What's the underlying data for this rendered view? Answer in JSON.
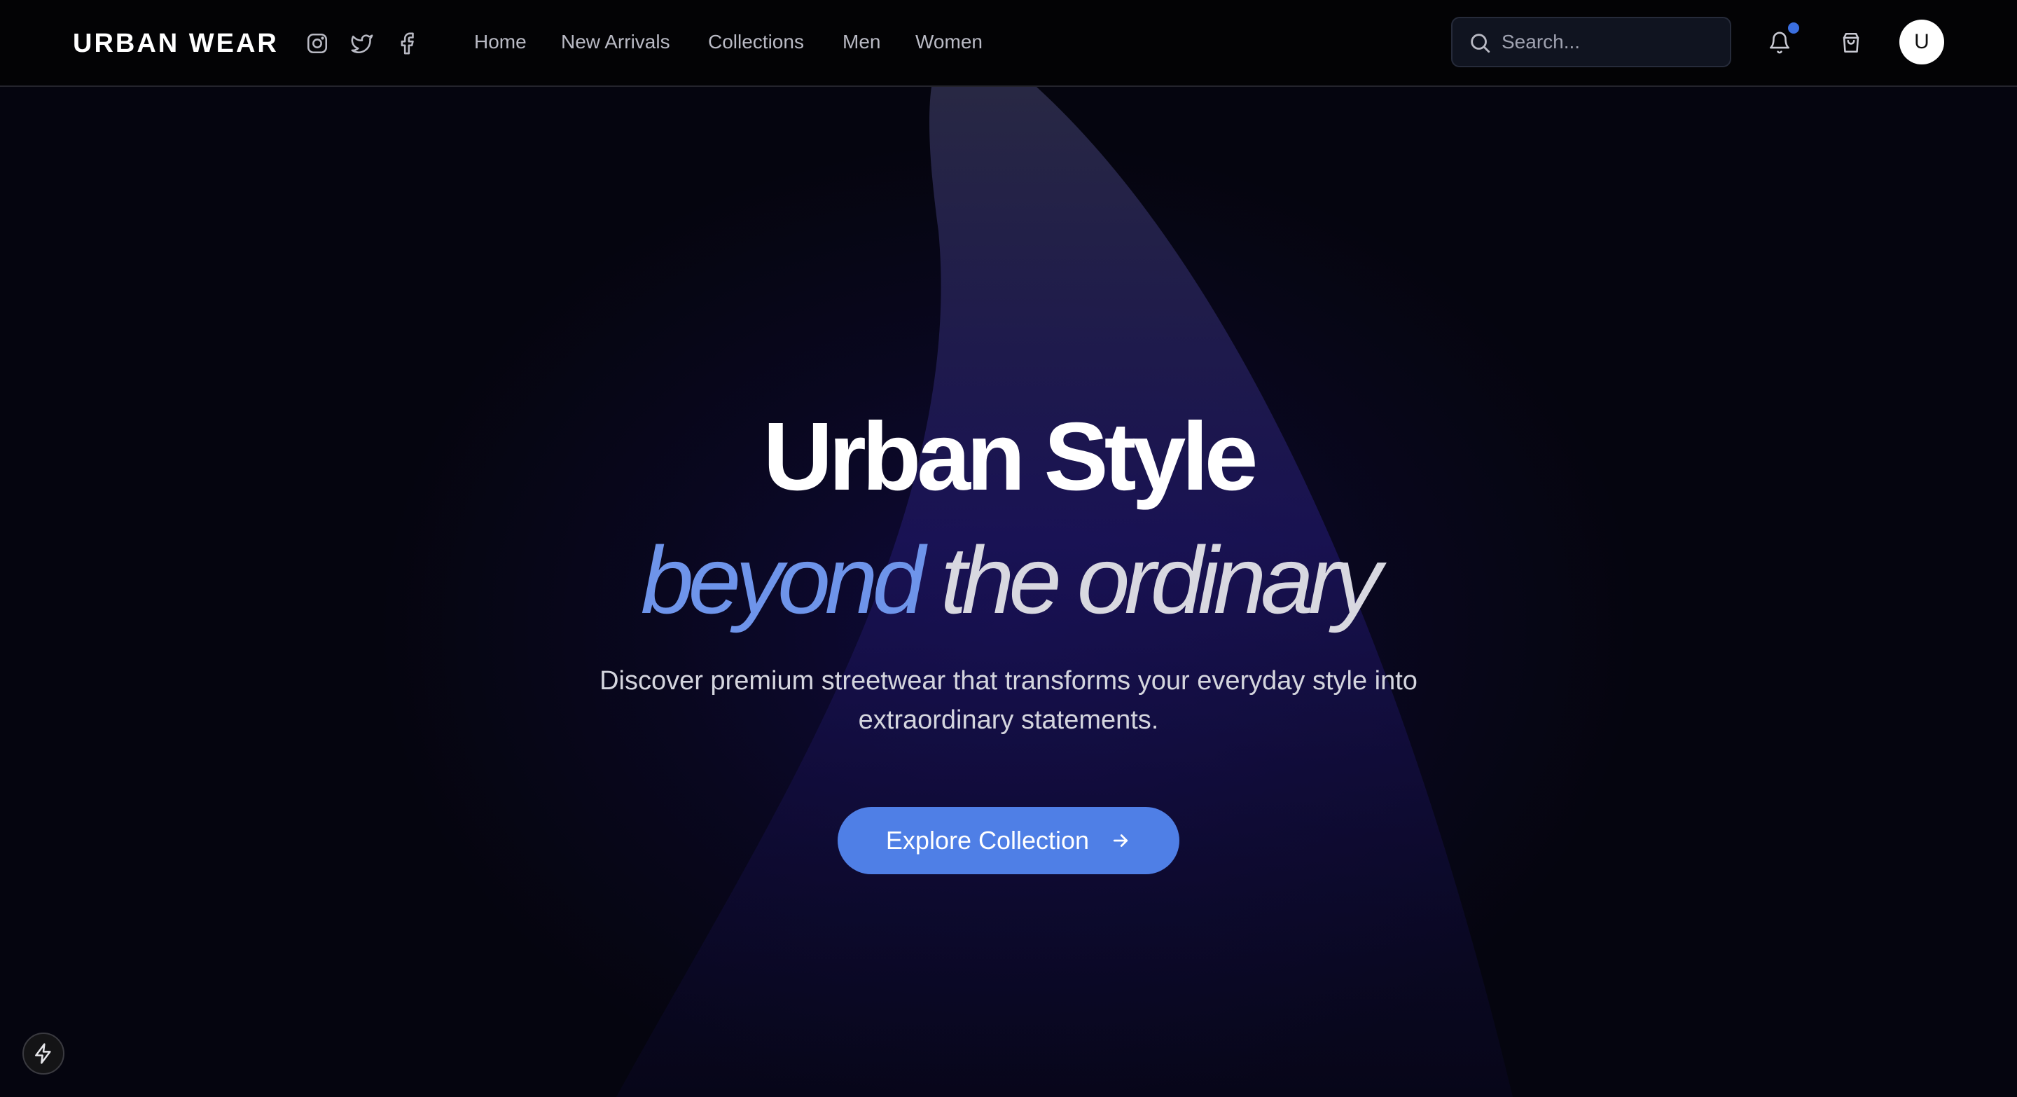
{
  "header": {
    "brand": "URBAN WEAR",
    "social": [
      {
        "icon": "instagram-icon"
      },
      {
        "icon": "twitter-icon"
      },
      {
        "icon": "facebook-icon"
      }
    ],
    "nav": [
      {
        "label": "Home"
      },
      {
        "label": "New Arrivals"
      },
      {
        "label": "Collections"
      },
      {
        "label": "Men"
      },
      {
        "label": "Women"
      }
    ],
    "search": {
      "placeholder": "Search..."
    },
    "notification_dot": true,
    "avatar_initial": "U"
  },
  "hero": {
    "title": "Urban Style",
    "subtitle_accent": "beyond",
    "subtitle_rest": "the ordinary",
    "description": "Discover premium streetwear that transforms your everyday style into extraordinary statements.",
    "cta_label": "Explore Collection"
  },
  "colors": {
    "accent": "#4f7fe6",
    "accent_text": "#6e94ea",
    "header_bg": "#030305",
    "hero_bg": "#09071f"
  }
}
